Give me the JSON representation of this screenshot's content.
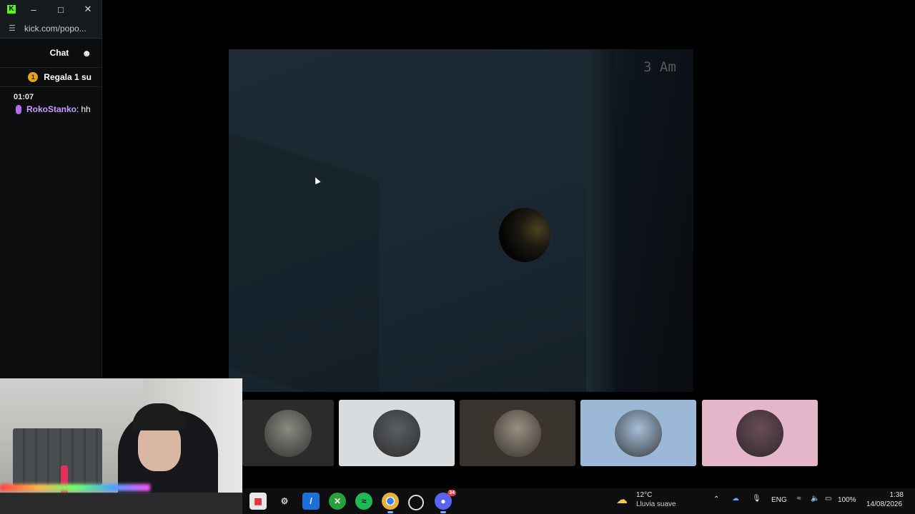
{
  "kick_window": {
    "url": "kick.com/popo...",
    "chat_label": "Chat",
    "gift_label": "Regala 1 su",
    "gift_count": "1",
    "messages": [
      {
        "time": "01:07",
        "user": "RokoStanko",
        "separator": ":",
        "text": "hh"
      }
    ]
  },
  "game": {
    "clock": "3 Am"
  },
  "tiles": [
    {
      "bg": "#2b2b2b",
      "avatar": "#8a8a80"
    },
    {
      "bg": "#d8dcdf",
      "avatar": "#5b5f63"
    },
    {
      "bg": "#3a342e",
      "avatar": "#9b8e80"
    },
    {
      "bg": "#9bb8d6",
      "avatar": "#a6bfd8"
    },
    {
      "bg": "#e5b6c9",
      "avatar": "#6a4c58"
    }
  ],
  "taskbar": {
    "weather_temp": "12°C",
    "weather_desc": "Lluvia suave",
    "language": "ENG",
    "battery": "100%",
    "time": "1:38",
    "date": "14/08/2026",
    "discord_badge": "34"
  }
}
